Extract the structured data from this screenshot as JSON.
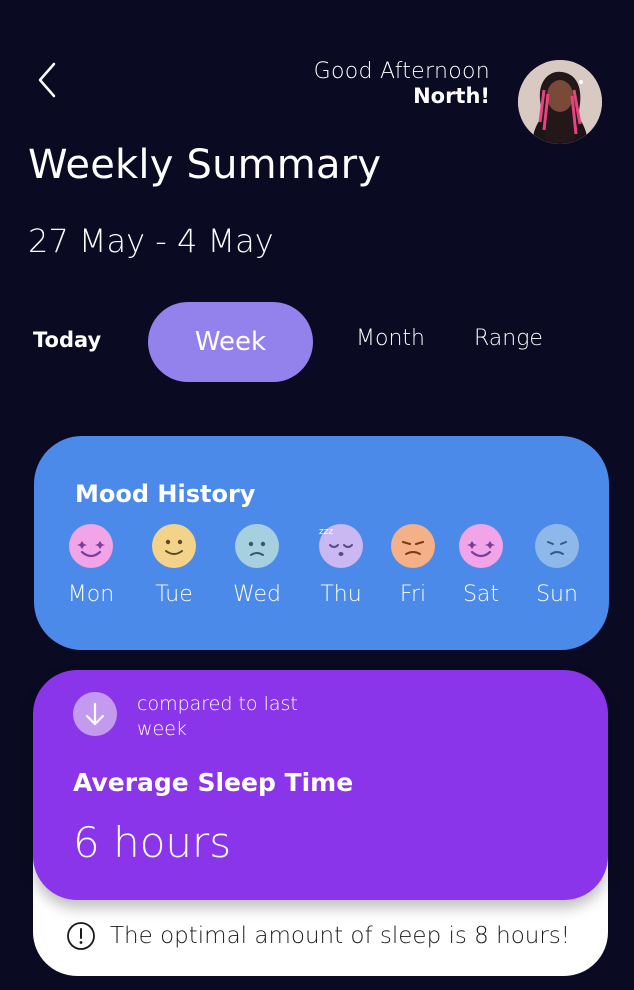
{
  "header": {
    "greeting": "Good Afternoon",
    "user_name": "North!"
  },
  "page_title": "Weekly Summary",
  "date_range": "27 May - 4 May",
  "tabs": [
    {
      "label": "Today"
    },
    {
      "label": "Week",
      "selected": true
    },
    {
      "label": "Month"
    },
    {
      "label": "Range"
    }
  ],
  "mood_history": {
    "heading": "Mood History",
    "days": [
      {
        "label": "Mon",
        "mood": "starry-eyed",
        "color": "#f2a4e8"
      },
      {
        "label": "Tue",
        "mood": "happy",
        "color": "#f3d38a"
      },
      {
        "label": "Wed",
        "mood": "sad",
        "color": "#a6cfe0"
      },
      {
        "label": "Thu",
        "mood": "sleepy",
        "color": "#c9b8f2"
      },
      {
        "label": "Fri",
        "mood": "annoyed",
        "color": "#f4b086"
      },
      {
        "label": "Sat",
        "mood": "starry-eyed",
        "color": "#f2a4e8"
      },
      {
        "label": "Sun",
        "mood": "sad",
        "color": "#8fb8ea"
      }
    ]
  },
  "sleep": {
    "compare_text": "compared to last week",
    "label": "Average Sleep Time",
    "value": "6 hours",
    "tip": "The optimal amount of sleep is 8 hours!",
    "trend": "down"
  },
  "colors": {
    "background": "#0a0a23",
    "tab_active": "#9382ec",
    "mood_card": "#4b8ae8",
    "sleep_card": "#8b35ea"
  }
}
